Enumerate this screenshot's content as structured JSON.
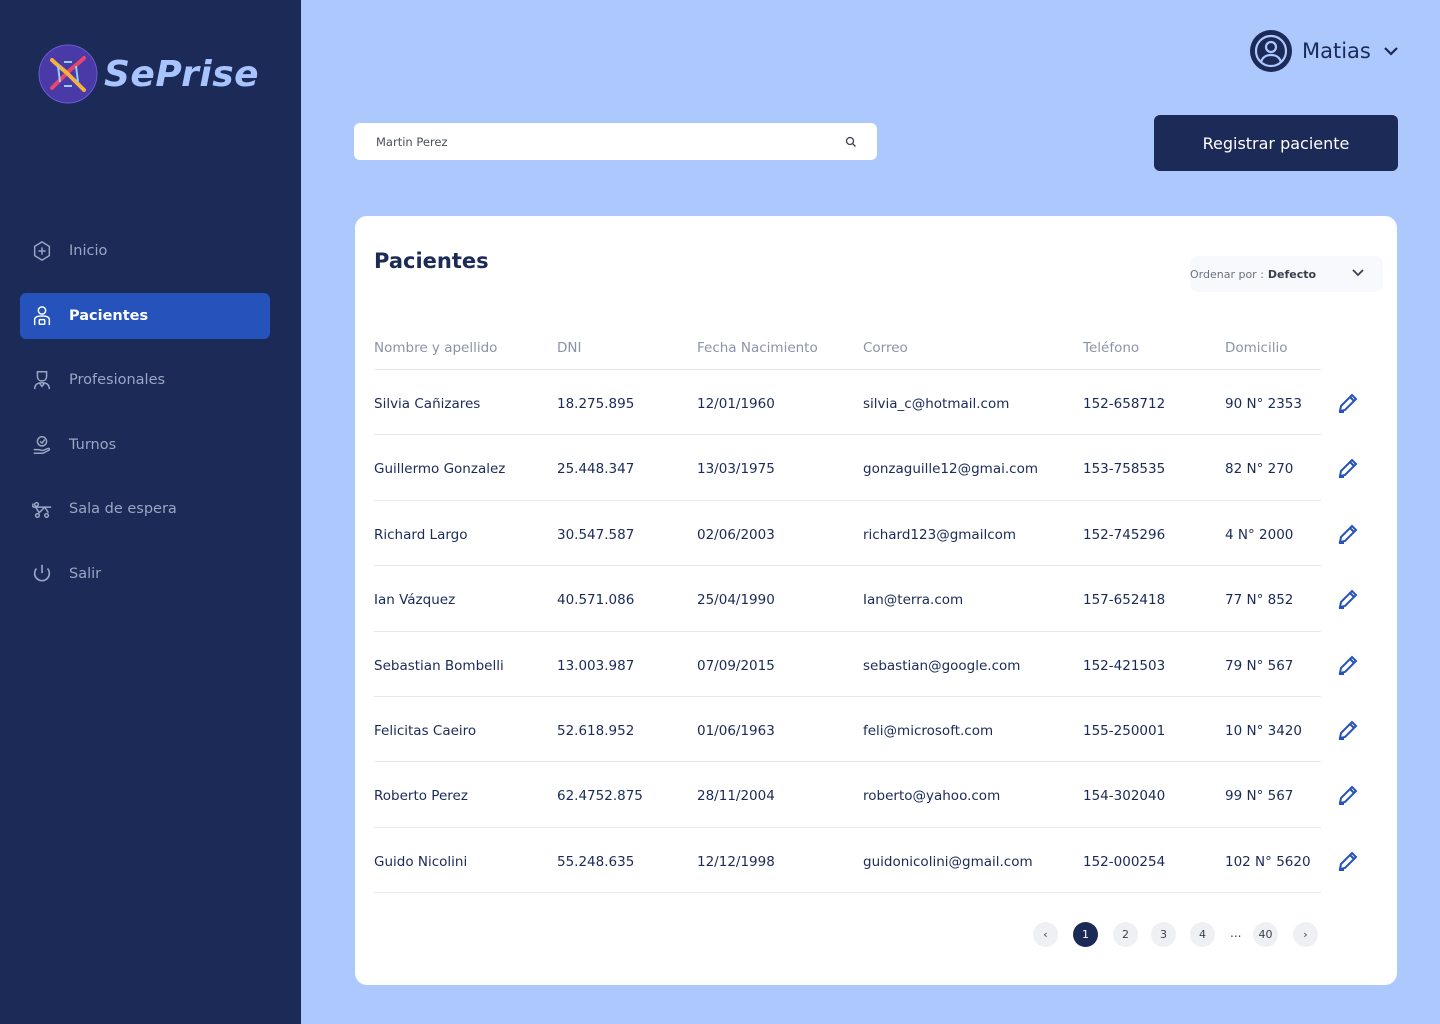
{
  "app": {
    "logo_text": "SePrise"
  },
  "sidebar": {
    "items": [
      {
        "label": "Inicio",
        "icon": "plus-circle-icon"
      },
      {
        "label": "Pacientes",
        "icon": "patient-icon",
        "active": true
      },
      {
        "label": "Profesionales",
        "icon": "doctor-icon"
      },
      {
        "label": "Turnos",
        "icon": "calendar-hand-icon"
      },
      {
        "label": "Sala de espera",
        "icon": "stretcher-icon"
      },
      {
        "label": "Salir",
        "icon": "power-icon"
      }
    ]
  },
  "header": {
    "user_name": "Matias"
  },
  "search": {
    "value": "Martin Perez",
    "placeholder": "Martin Perez"
  },
  "actions": {
    "register_label": "Registrar paciente"
  },
  "patients": {
    "title": "Pacientes",
    "sort_label": "Ordenar por :",
    "sort_value": "Defecto",
    "columns": [
      "Nombre y apellido",
      "DNI",
      "Fecha Nacimiento",
      "Correo",
      "Teléfono",
      "Domicilio"
    ],
    "rows": [
      [
        "Silvia Cañizares",
        "18.275.895",
        "12/01/1960",
        "silvia_c@hotmail.com",
        "152-658712",
        "90 N° 2353"
      ],
      [
        "Guillermo Gonzalez",
        "25.448.347",
        "13/03/1975",
        "gonzaguille12@gmai.com",
        "153-758535",
        "82 N° 270"
      ],
      [
        "Richard Largo",
        "30.547.587",
        "02/06/2003",
        "richard123@gmailcom",
        "152-745296",
        "4 N° 2000"
      ],
      [
        "Ian Vázquez",
        "40.571.086",
        "25/04/1990",
        "Ian@terra.com",
        "157-652418",
        "77 N° 852"
      ],
      [
        "Sebastian Bombelli",
        "13.003.987",
        "07/09/2015",
        "sebastian@google.com",
        "152-421503",
        "79 N° 567"
      ],
      [
        "Felicitas Caeiro",
        "52.618.952",
        "01/06/1963",
        "feli@microsoft.com",
        "155-250001",
        "10 N° 3420"
      ],
      [
        "Roberto Perez",
        "62.4752.875",
        "28/11/2004",
        "roberto@yahoo.com",
        "154-302040",
        "99 N° 567"
      ],
      [
        "Guido Nicolini",
        "55.248.635",
        "12/12/1998",
        "guidonicolini@gmail.com",
        "152-000254",
        "102 N° 5620"
      ]
    ]
  },
  "pagination": {
    "prev": "‹",
    "next": "›",
    "pages": [
      "1",
      "2",
      "3",
      "4"
    ],
    "ellipsis": "...",
    "last": "40",
    "current": "1"
  },
  "colors": {
    "sidebar_bg": "#1b2a57",
    "page_bg": "#adc8fd",
    "active_nav": "#2553bb",
    "accent": "#2553bb"
  }
}
